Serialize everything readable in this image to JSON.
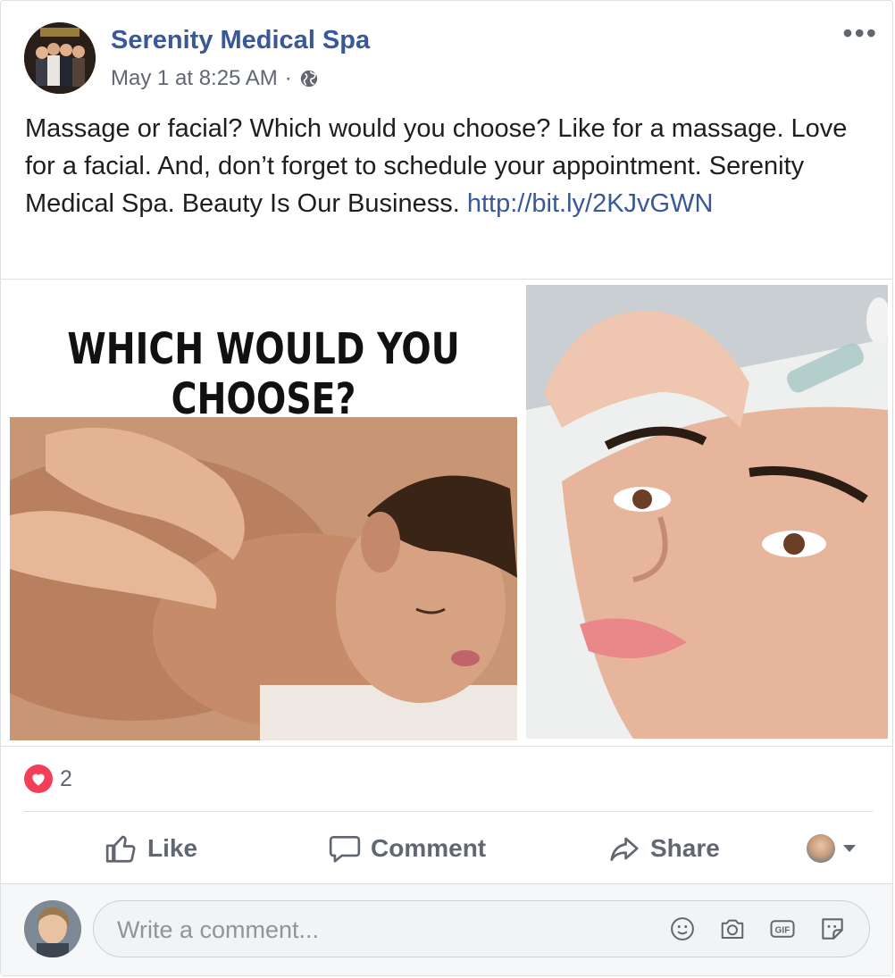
{
  "post": {
    "page_name": "Serenity Medical Spa",
    "timestamp": "May 1 at 8:25 AM",
    "separator": "·",
    "visibility_icon": "globe-icon",
    "more_icon": "•••",
    "text": "Massage or facial? Which would you choose? Like for a massage. Love for a facial. And, don’t forget to schedule your appointment. Serenity Medical Spa. Beauty Is Our Business. ",
    "link_text": "http://bit.ly/2KJvGWN"
  },
  "image": {
    "headline": "WHICH WOULD YOU CHOOSE?"
  },
  "reactions": {
    "icon": "heart-icon",
    "count": "2"
  },
  "actions": {
    "like_label": "Like",
    "comment_label": "Comment",
    "share_label": "Share"
  },
  "comment": {
    "placeholder": "Write a comment...",
    "tools": [
      "emoji-icon",
      "camera-icon",
      "gif-icon",
      "sticker-icon"
    ]
  },
  "colors": {
    "brand_blue": "#385898",
    "muted": "#606770",
    "heart": "#f33e58"
  }
}
